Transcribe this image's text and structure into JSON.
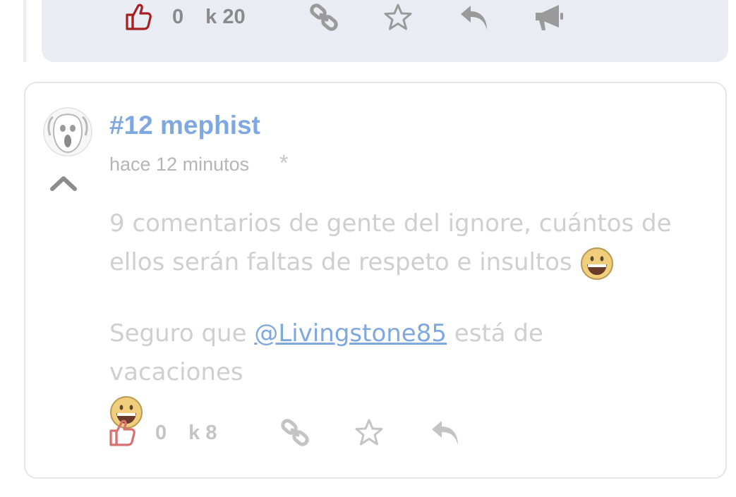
{
  "previous_comment": {
    "votes": "0",
    "karma": "k 20",
    "icons": [
      "thumbs-up-icon",
      "link-icon",
      "star-icon",
      "reply-icon",
      "megaphone-icon"
    ]
  },
  "comment": {
    "number_author": "#12 mephist",
    "time": "hace 12 minutos",
    "marker": "*",
    "paragraph1": "9 comentarios de gente del ignore, cuántos de ellos serán faltas de respeto e insultos",
    "paragraph2_prefix": "Seguro que ",
    "mention": "@Livingstone85",
    "paragraph2_suffix": " está de vacaciones",
    "votes": "0",
    "karma": "k 8",
    "icons": [
      "thumbs-up-icon",
      "link-icon",
      "star-icon",
      "reply-icon"
    ]
  },
  "colors": {
    "accent_link": "#7fa8e0",
    "vote_icon_active": "#a52020",
    "vote_icon_faded": "#d97070",
    "action_icon": "#9a9a9a",
    "prev_card_bg": "#e9ecf3"
  }
}
